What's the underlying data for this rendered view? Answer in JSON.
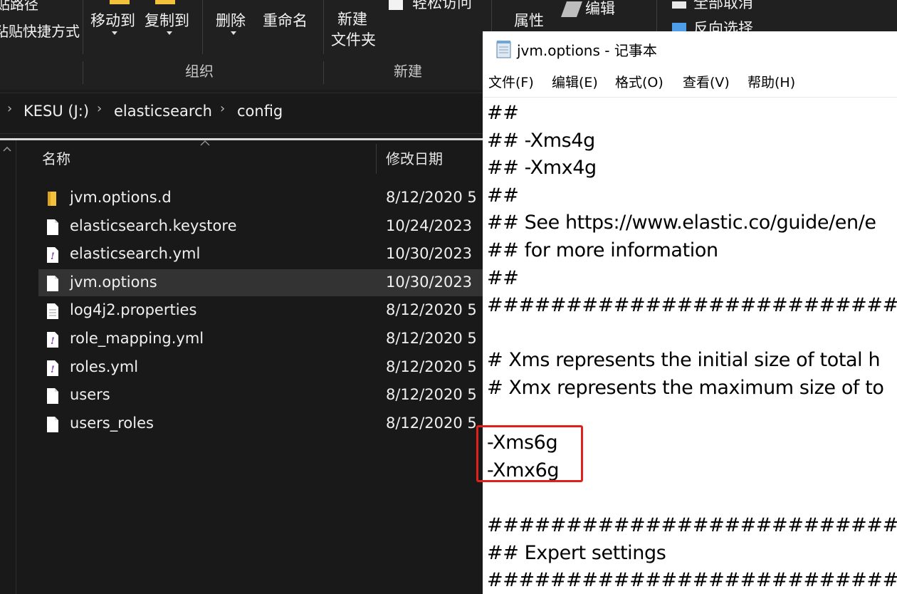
{
  "explorer": {
    "ribbon": {
      "clipped_left_top": "贴路径",
      "paste_shortcut": "粘贴快捷方式",
      "move_to": "移动到",
      "copy_to": "复制到",
      "delete": "删除",
      "rename": "重命名",
      "new_folder_line1": "新建",
      "new_folder_line2": "文件夹",
      "easy_access": "轻松访问",
      "properties": "属性",
      "edit": "编辑",
      "select_none": "全部取消",
      "invert_selection": "反向选择",
      "group_organize": "组织",
      "group_new": "新建"
    },
    "breadcrumb": [
      "KESU (J:)",
      "elasticsearch",
      "config"
    ],
    "columns": {
      "name": "名称",
      "modified": "修改日期"
    },
    "files": [
      {
        "name": "jvm.options.d",
        "date": "8/12/2020 5",
        "icon": "folder-icon"
      },
      {
        "name": "elasticsearch.keystore",
        "date": "10/24/2023",
        "icon": "file-icon"
      },
      {
        "name": "elasticsearch.yml",
        "date": "10/30/2023",
        "icon": "yml-file-icon"
      },
      {
        "name": "jvm.options",
        "date": "10/30/2023",
        "icon": "file-icon",
        "selected": true
      },
      {
        "name": "log4j2.properties",
        "date": "8/12/2020 5",
        "icon": "text-file-icon"
      },
      {
        "name": "role_mapping.yml",
        "date": "8/12/2020 5",
        "icon": "yml-file-icon"
      },
      {
        "name": "roles.yml",
        "date": "8/12/2020 5",
        "icon": "yml-file-icon"
      },
      {
        "name": "users",
        "date": "8/12/2020 5",
        "icon": "file-icon"
      },
      {
        "name": "users_roles",
        "date": "8/12/2020 5",
        "icon": "file-icon"
      }
    ]
  },
  "notepad": {
    "title": "jvm.options - 记事本",
    "menu": [
      "文件(F)",
      "编辑(E)",
      "格式(O)",
      "查看(V)",
      "帮助(H)"
    ],
    "lines": [
      "##",
      "## -Xms4g",
      "## -Xmx4g",
      "##",
      "## See https://www.elastic.co/guide/en/e",
      "## for more information",
      "##",
      "################################",
      "",
      "# Xms represents the initial size of total h",
      "# Xmx represents the maximum size of to",
      "",
      "-Xms6g",
      "-Xmx6g",
      "",
      "################################",
      "## Expert settings",
      "################################"
    ]
  },
  "colors": {
    "explorer_bg": "#191919",
    "ribbon_bg": "#202020",
    "selection": "#333333",
    "highlight_box": "#e0201b",
    "folder": "#f3c13a",
    "yml_mark": "#7b3fb3"
  }
}
